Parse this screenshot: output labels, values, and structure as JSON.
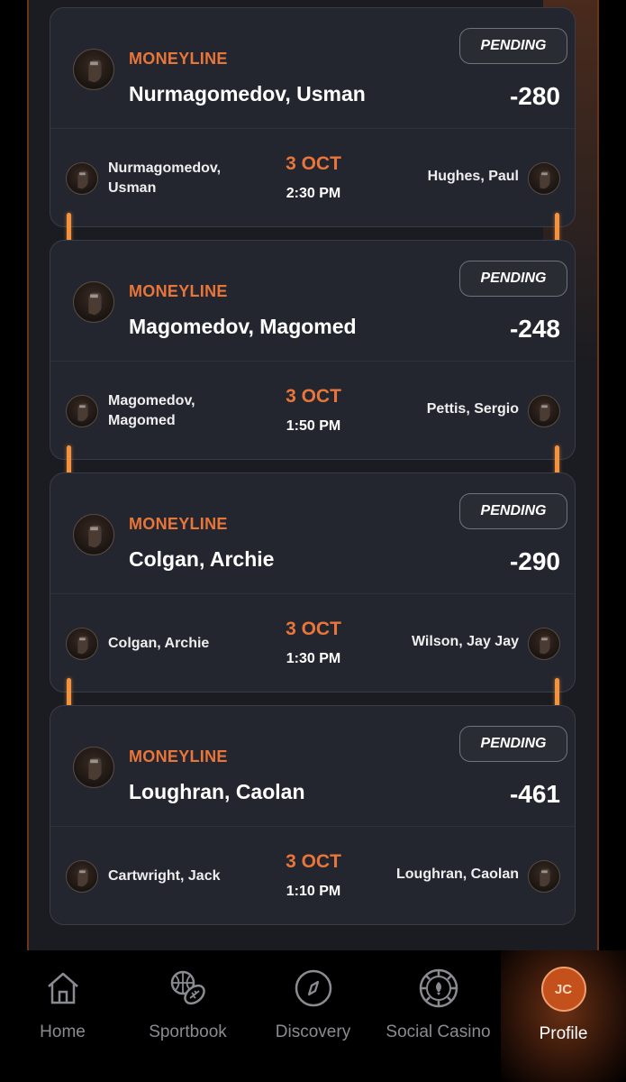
{
  "bets": [
    {
      "market": "MONEYLINE",
      "selection": "Nurmagomedov, Usman",
      "odds": "-280",
      "status": "PENDING",
      "team_left": "Nurmagomedov, Usman",
      "team_right": "Hughes, Paul",
      "date": "3 OCT",
      "time": "2:30 PM"
    },
    {
      "market": "MONEYLINE",
      "selection": "Magomedov, Magomed",
      "odds": "-248",
      "status": "PENDING",
      "team_left": "Magomedov, Magomed",
      "team_right": "Pettis, Sergio",
      "date": "3 OCT",
      "time": "1:50 PM"
    },
    {
      "market": "MONEYLINE",
      "selection": "Colgan, Archie",
      "odds": "-290",
      "status": "PENDING",
      "team_left": "Colgan, Archie",
      "team_right": "Wilson, Jay Jay",
      "date": "3 OCT",
      "time": "1:30 PM"
    },
    {
      "market": "MONEYLINE",
      "selection": "Loughran, Caolan",
      "odds": "-461",
      "status": "PENDING",
      "team_left": "Cartwright, Jack",
      "team_right": "Loughran, Caolan",
      "date": "3 OCT",
      "time": "1:10 PM"
    }
  ],
  "nav": {
    "items": [
      {
        "label": "Home",
        "icon": "home-icon"
      },
      {
        "label": "Sportbook",
        "icon": "sports-balls-icon"
      },
      {
        "label": "Discovery",
        "icon": "compass-icon"
      },
      {
        "label": "Social Casino",
        "icon": "casino-chip-icon"
      },
      {
        "label": "Profile",
        "icon": "avatar",
        "initials": "JC",
        "active": true
      }
    ]
  },
  "colors": {
    "accent": "#e8753a",
    "connector": "#f5923e",
    "card": "#24262f",
    "background": "#000000"
  }
}
